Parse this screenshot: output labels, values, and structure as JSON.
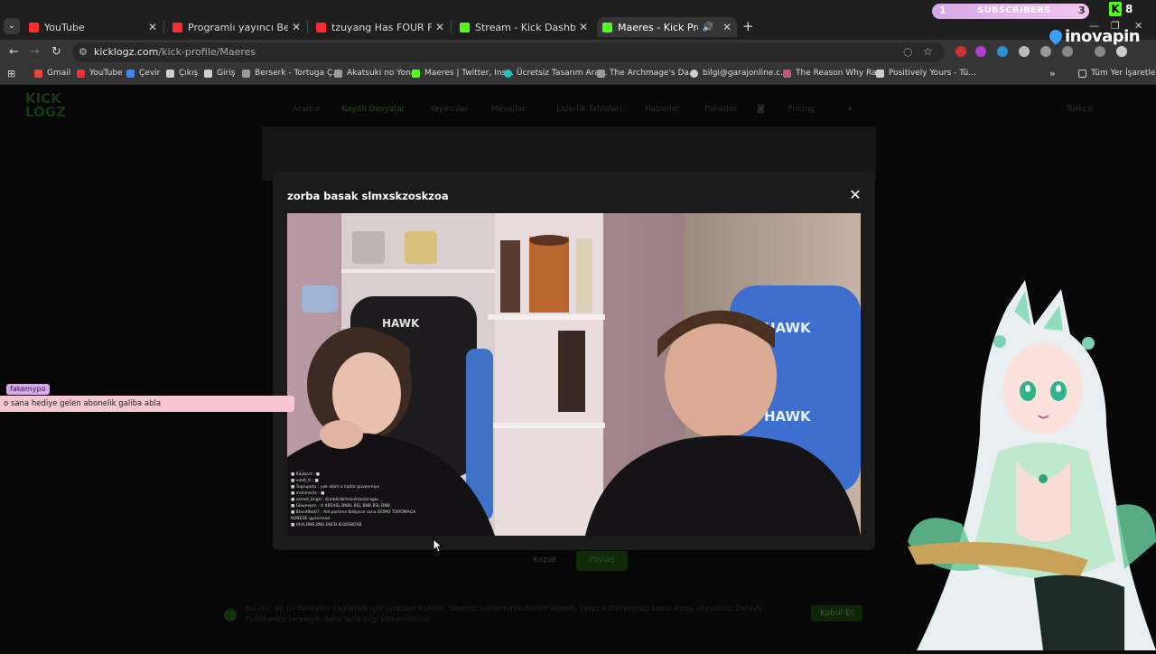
{
  "browser": {
    "tabs": [
      {
        "title": "YouTube",
        "favicon": "youtube-icon",
        "color": "#ff2b2b",
        "active": false
      },
      {
        "title": "Programlı yayıncı Beskok gülmek",
        "favicon": "youtube-icon",
        "color": "#ff2b2b",
        "active": false
      },
      {
        "title": "tzuyang Has FOUR Fridges?! W",
        "favicon": "youtube-icon",
        "color": "#ff2b2b",
        "active": false
      },
      {
        "title": "Stream - Kick Dashboard",
        "favicon": "kick-icon",
        "color": "#53fc18",
        "active": false
      },
      {
        "title": "Maeres - Kick Profili",
        "favicon": "kick-icon",
        "color": "#53fc18",
        "active": true
      }
    ],
    "url_host": "kicklogz.com",
    "url_path": "/kick-profile/Maeres",
    "bookmarks": [
      {
        "label": "Gmail",
        "icon": "gmail-icon",
        "color": "#ea4335"
      },
      {
        "label": "YouTube",
        "icon": "youtube-icon",
        "color": "#ff2b2b"
      },
      {
        "label": "Çevir",
        "icon": "translate-icon",
        "color": "#4285f4"
      },
      {
        "label": "Çıkış",
        "icon": "page-icon",
        "color": "#cfcfcf"
      },
      {
        "label": "Giriş",
        "icon": "page-icon",
        "color": "#cfcfcf"
      },
      {
        "label": "Berserk - Tortuga Ç...",
        "icon": "ship-icon",
        "color": "#9a9a9a"
      },
      {
        "label": "Akatsuki no Yona",
        "icon": "gear-icon",
        "color": "#9a9a9a"
      },
      {
        "label": "Maeres | Twitter, Ins...",
        "icon": "kick-icon",
        "color": "#53fc18"
      },
      {
        "label": "Ücretsiz Tasarım Ara...",
        "icon": "canva-icon",
        "color": "#20c4cb"
      },
      {
        "label": "The Archmage's Da...",
        "icon": "page-icon",
        "color": "#9a9a9a"
      },
      {
        "label": "bilgi@garajonline.c...",
        "icon": "globe-icon",
        "color": "#cfcfcf"
      },
      {
        "label": "The Reason Why Ra...",
        "icon": "book-icon",
        "color": "#c0587a"
      },
      {
        "label": "Positively Yours - Tü...",
        "icon": "page-icon",
        "color": "#cfcfcf"
      }
    ],
    "all_bookmarks": "Tüm Yer İşaretleri"
  },
  "overlay": {
    "subscribers_left": "1",
    "subscribers_label": "SUBSCRIBERS",
    "subscribers_right": "3",
    "kick_count": "8",
    "sponsor": "inovapin"
  },
  "page": {
    "logo_line1": "KICK",
    "logo_line2": "LOGZ",
    "nav": [
      "Arama",
      "Kayıtlı Dosyalar",
      "Yayıncılar",
      "Mesajlar",
      "Liderlik Tabloları",
      "Haberler",
      "Paketler",
      "",
      "Pricing"
    ],
    "language": "Türkçe",
    "button_close": "Kapat",
    "button_share": "Paylaş",
    "cookie_text": "Bu site, en iyi deneyimi sağlamak için çerezleri kullanır. Sitemizi kullanmaya devam ederek, çerez kullanımımızı kabul etmiş olursunuz. Detaylı Politikamızı inceleyin daha fazla bilgi edinebilirsiniz.",
    "cookie_ok": "Kabul Et"
  },
  "modal": {
    "title": "zorba basak slmxskzoskzoa",
    "close_symbol": "✕",
    "video_alt": "Clip: two streamers sitting in Hawk gaming chairs"
  },
  "chat": {
    "username": "fakemypo",
    "message": "o sana hediye gelen abonelik galiba abla"
  },
  "colors": {
    "kick_green": "#53fc18",
    "modal_bg": "#1b1b1b",
    "chat_bubble": "#f6c7d2"
  }
}
